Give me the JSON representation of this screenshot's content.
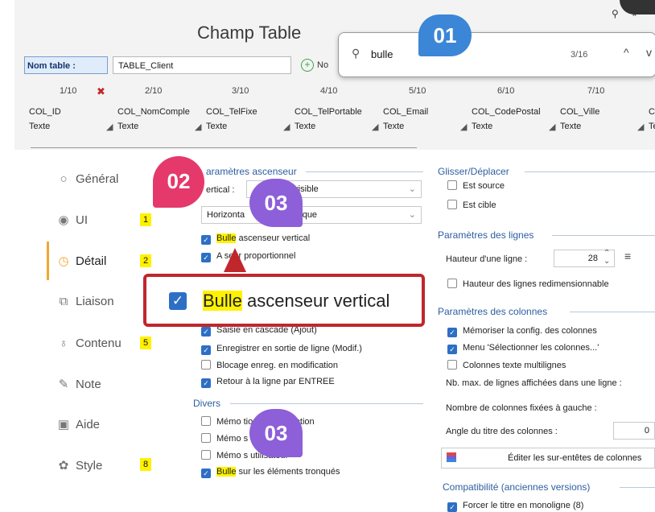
{
  "window": {
    "title": "Champ Table"
  },
  "toolbar_icons": [
    "pin-icon",
    "unpin-icon"
  ],
  "search": {
    "query": "bulle",
    "count": "3/16",
    "prev": "^",
    "next": "v"
  },
  "badges": {
    "b01": "01",
    "b02": "02",
    "b03a": "03",
    "b03b": "03"
  },
  "table_name": {
    "label": "Nom table :",
    "value": "TABLE_Client",
    "new_button": "No"
  },
  "columns": [
    {
      "num": "1/10",
      "name": "COL_ID",
      "type": "Texte"
    },
    {
      "num": "2/10",
      "name": "COL_NomComple",
      "type": "Texte"
    },
    {
      "num": "3/10",
      "name": "COL_TelFixe",
      "type": "Texte"
    },
    {
      "num": "4/10",
      "name": "COL_TelPortable",
      "type": "Texte"
    },
    {
      "num": "5/10",
      "name": "COL_Email",
      "type": "Texte"
    },
    {
      "num": "6/10",
      "name": "COL_CodePostal",
      "type": "Texte"
    },
    {
      "num": "7/10",
      "name": "COL_Ville",
      "type": "Texte"
    },
    {
      "num": "",
      "name": "C",
      "type": "Te"
    }
  ],
  "sidebar": [
    {
      "label": "Général",
      "icon": "radio-icon",
      "count": ""
    },
    {
      "label": "UI",
      "icon": "eye-radio-icon",
      "count": "1"
    },
    {
      "label": "Détail",
      "icon": "clock-icon",
      "count": "2"
    },
    {
      "label": "Liaison",
      "icon": "link-icon",
      "count": ""
    },
    {
      "label": "Contenu",
      "icon": "flask-icon",
      "count": "5"
    },
    {
      "label": "Note",
      "icon": "pencil-icon",
      "count": ""
    },
    {
      "label": "Aide",
      "icon": "help-icon",
      "count": ""
    },
    {
      "label": "Style",
      "icon": "palette-icon",
      "count": "8"
    }
  ],
  "scroll_section": {
    "title": "aramètres ascenseur",
    "vertical_label": "ertical :",
    "vertical_value": "rs visible",
    "horizontal_label": "Horizonta",
    "horizontal_value": "atique",
    "items": [
      {
        "hl": "Bulle",
        "rest": " ascenseur vertical",
        "checked": true
      },
      {
        "hl": "",
        "rest": "A   seur proportionnel",
        "checked": true
      }
    ]
  },
  "callout": {
    "hl": "Bulle",
    "rest": " ascenseur vertical"
  },
  "edit_items": [
    {
      "label": "Saisie en cascade (Ajout)",
      "checked": true
    },
    {
      "label": "Enregistrer en sortie de ligne (Modif.)",
      "checked": true
    },
    {
      "label": "Blocage enreg. en modification",
      "checked": false
    },
    {
      "label": "Retour à la ligne par ENTREE",
      "checked": true
    }
  ],
  "divers": {
    "title": "Divers",
    "items": [
      {
        "hl": "",
        "rest": "Mémo         tion et la sélection",
        "checked": false
      },
      {
        "hl": "",
        "rest": "Mémo           s utilisateur",
        "checked": false
      },
      {
        "hl": "",
        "rest": "Mémo           s utilisateur",
        "checked": false
      },
      {
        "hl": "Bulle",
        "rest": " sur les éléments tronqués",
        "checked": true
      }
    ]
  },
  "drag": {
    "title": "Glisser/Déplacer",
    "items": [
      {
        "label": "Est source",
        "checked": false
      },
      {
        "label": "Est cible",
        "checked": false
      }
    ]
  },
  "lines": {
    "title": "Paramètres des lignes",
    "height_label": "Hauteur d'une ligne :",
    "height_value": "28",
    "resizable": "Hauteur des lignes redimensionnable"
  },
  "columns_params": {
    "title": "Paramètres des colonnes",
    "items": [
      {
        "label": "Mémoriser la config. des colonnes",
        "checked": true
      },
      {
        "label": "Menu 'Sélectionner les colonnes...'",
        "checked": true
      },
      {
        "label": "Colonnes texte multilignes",
        "checked": false
      }
    ],
    "max_lines": "Nb. max. de lignes affichées dans une ligne :",
    "fixed_cols": "Nombre de colonnes fixées à gauche :",
    "angle": "Angle du titre des colonnes :",
    "angle_value": "0",
    "edit_headers": "Éditer les sur-entêtes de colonnes"
  },
  "compat": {
    "title": "Compatibilité (anciennes versions)",
    "item": "Forcer le titre en monoligne (8)"
  },
  "colors": {
    "accent": "#2d6fc5",
    "highlight": "#fff200",
    "callout_border": "#c0272d",
    "badge_blue": "#3b86d6",
    "badge_pink": "#e5396b",
    "badge_purple": "#8d5fd9"
  }
}
